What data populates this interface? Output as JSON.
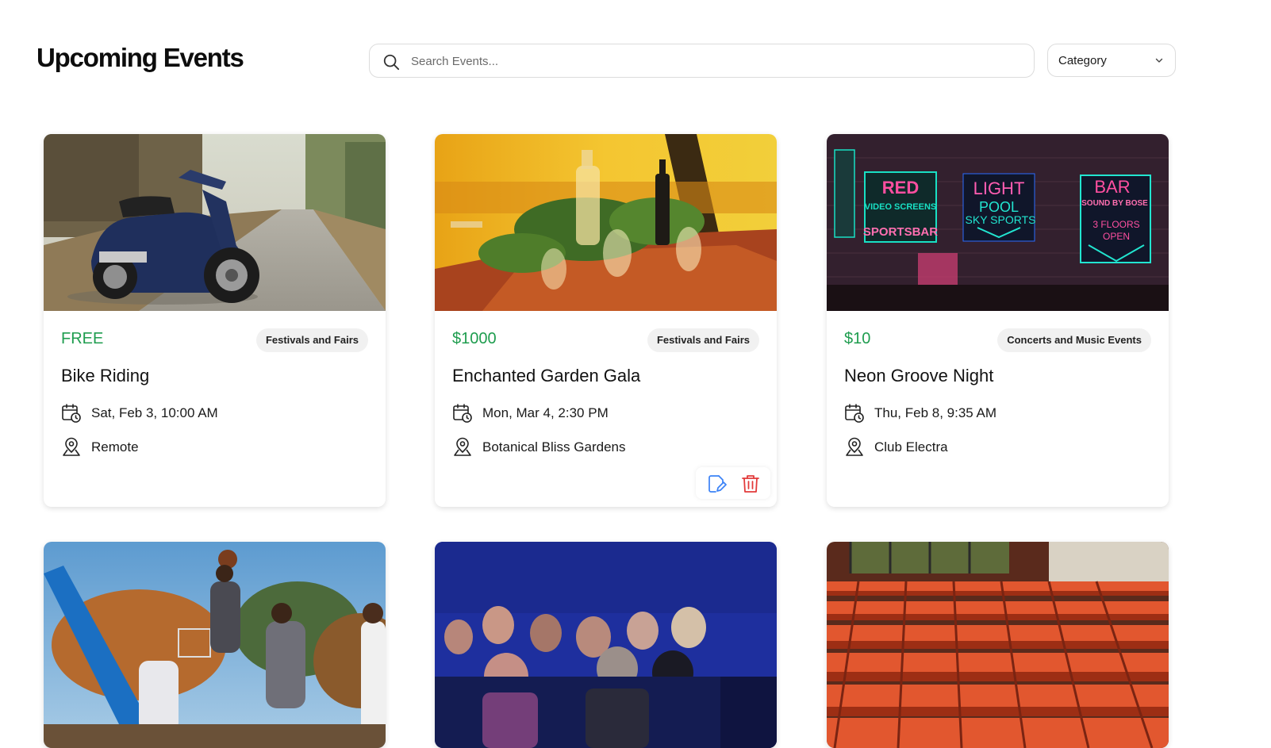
{
  "header": {
    "title": "Upcoming Events",
    "search_placeholder": "Search Events...",
    "category_label": "Category"
  },
  "colors": {
    "price": "#1f9d4f",
    "edit_icon": "#3b82f6",
    "delete_icon": "#e23b3b",
    "badge_bg": "#f1f1f1"
  },
  "events": [
    {
      "price": "FREE",
      "category": "Festivals and Fairs",
      "name": "Bike Riding",
      "datetime": "Sat, Feb 3, 10:00 AM",
      "location": "Remote",
      "image": "scooter on road"
    },
    {
      "price": "$1000",
      "category": "Festivals and Fairs",
      "name": "Enchanted Garden Gala",
      "datetime": "Mon, Mar 4, 2:30 PM",
      "location": "Botanical Bliss Gardens",
      "image": "dinner table with glassware"
    },
    {
      "price": "$10",
      "category": "Concerts and Music Events",
      "name": "Neon Groove Night",
      "datetime": "Thu, Feb 8, 9:35 AM",
      "location": "Club Electra",
      "image": "neon signs",
      "signs": [
        "RED",
        "VIDEO SCREENS",
        "SPORTSBAR",
        "LIGHT",
        "POOL",
        "SKY SPORTS",
        "BAR",
        "SOUND BY BOSE",
        "3 FLOORS",
        "OPEN"
      ]
    },
    {
      "image": "basketball game"
    },
    {
      "image": "audience in dark theater"
    },
    {
      "image": "rows of red theater seats"
    }
  ]
}
